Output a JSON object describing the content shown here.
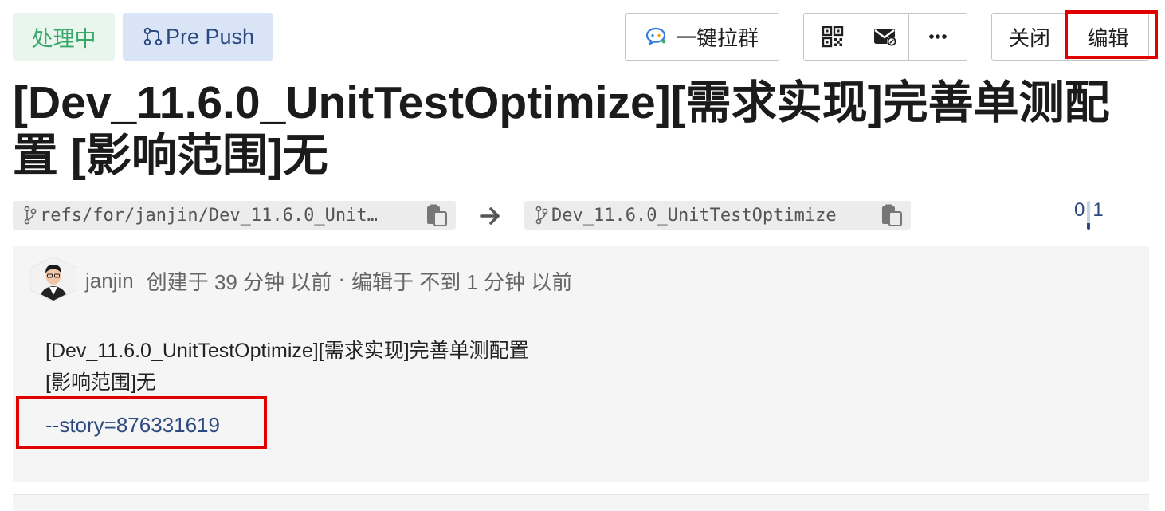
{
  "status": {
    "label": "处理中"
  },
  "flow": {
    "label": "Pre Push"
  },
  "toolbar": {
    "group_chat_label": "一键拉群",
    "close_label": "关闭",
    "edit_label": "编辑"
  },
  "title": "[Dev_11.6.0_UnitTestOptimize][需求实现]完善单测配置 [影响范围]无",
  "refs": {
    "source": "refs/for/janjin/Dev_11.6.0_Unit…",
    "target": "Dev_11.6.0_UnitTestOptimize"
  },
  "counter": {
    "left": "0",
    "right": "1"
  },
  "activity": {
    "author": "janjin",
    "created": "创建于 39 分钟 以前",
    "separator": "·",
    "edited": "编辑于 不到 1 分钟 以前"
  },
  "description": {
    "line1": "[Dev_11.6.0_UnitTestOptimize][需求实现]完善单测配置",
    "line2": "[影响范围]无",
    "story": "--story=876331619"
  },
  "colors": {
    "status_bg": "#e8f6ed",
    "status_text": "#3aa86b",
    "flow_bg": "#d9e5f7",
    "flow_text": "#2c4a80",
    "highlight": "#e00000"
  }
}
